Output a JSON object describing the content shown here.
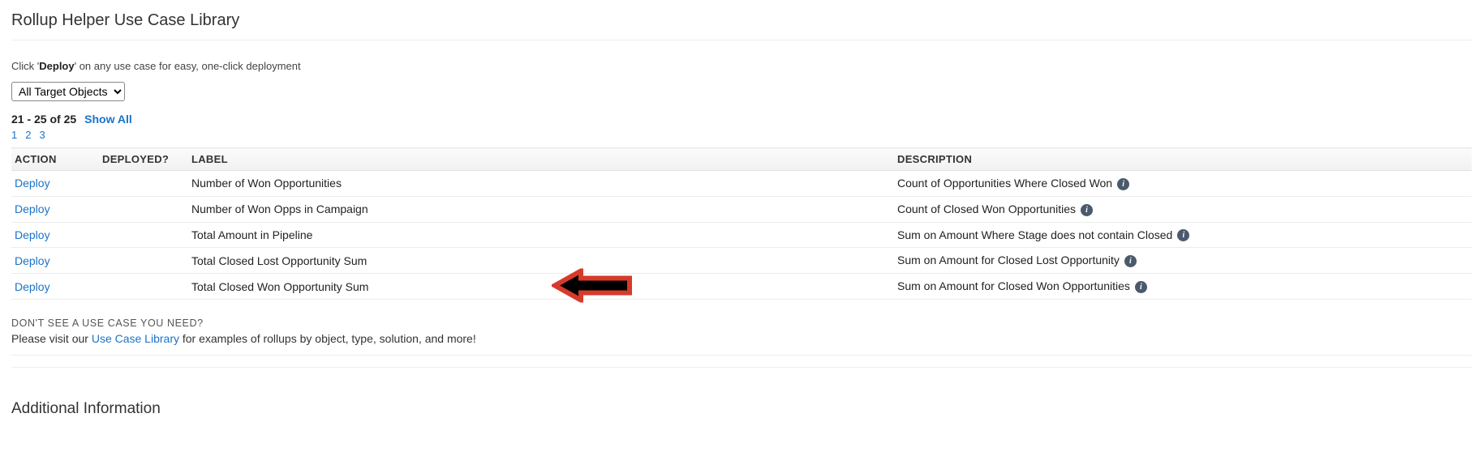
{
  "title": "Rollup Helper Use Case Library",
  "subtext_pre": "Click '",
  "subtext_bold": "Deploy",
  "subtext_post": "' on any use case for easy, one-click deployment",
  "targetSelect": {
    "selected": "All Target Objects"
  },
  "pagination": {
    "range": "21 - 25 of 25",
    "showAll": "Show All",
    "pages": [
      "1",
      "2",
      "3"
    ]
  },
  "columns": {
    "action": "ACTION",
    "deployed": "DEPLOYED?",
    "label": "LABEL",
    "description": "DESCRIPTION"
  },
  "rows": [
    {
      "action": "Deploy",
      "deployed": "",
      "label": "Number of Won Opportunities",
      "description": "Count of Opportunities Where Closed Won",
      "highlight": false
    },
    {
      "action": "Deploy",
      "deployed": "",
      "label": "Number of Won Opps in Campaign",
      "description": "Count of Closed Won Opportunities",
      "highlight": false
    },
    {
      "action": "Deploy",
      "deployed": "",
      "label": "Total Amount in Pipeline",
      "description": "Sum on Amount Where Stage does not contain Closed",
      "highlight": false
    },
    {
      "action": "Deploy",
      "deployed": "",
      "label": "Total Closed Lost Opportunity Sum",
      "description": "Sum on Amount for Closed Lost Opportunity",
      "highlight": false
    },
    {
      "action": "Deploy",
      "deployed": "",
      "label": "Total Closed Won Opportunity Sum",
      "description": "Sum on Amount for Closed Won Opportunities",
      "highlight": true
    }
  ],
  "footer": {
    "title": "DON'T SEE A USE CASE YOU NEED?",
    "pre": "Please visit our ",
    "link": "Use Case Library",
    "post": " for examples of rollups by object, type, solution, and more!"
  },
  "additional": "Additional Information"
}
